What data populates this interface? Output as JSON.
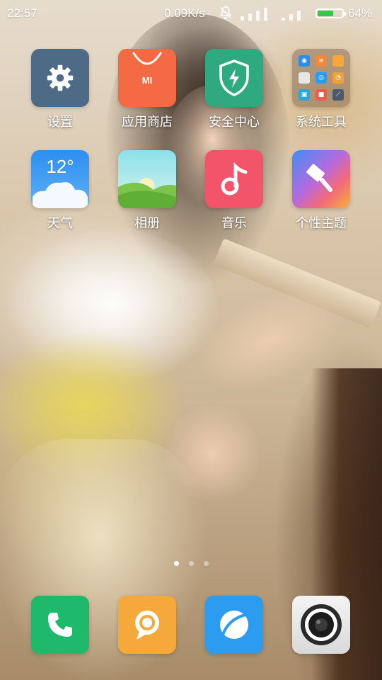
{
  "status_bar": {
    "time": "22:57",
    "net_speed": "0.09K/s",
    "battery_percent": "64%",
    "battery_level": 0.64,
    "battery_color": "#35c94a"
  },
  "home": {
    "rows": [
      [
        {
          "label": "设置",
          "icon": "gear-icon",
          "color": "#4d6a87"
        },
        {
          "label": "应用商店",
          "icon": "shopping-bag-icon",
          "color": "#f46a45",
          "icon_text": "MI"
        },
        {
          "label": "安全中心",
          "icon": "shield-lightning-icon",
          "color": "#2faa80"
        },
        {
          "label": "系统工具",
          "icon": "folder-icon",
          "color": "#7a5c46"
        }
      ],
      [
        {
          "label": "天气",
          "icon": "weather-cloud-icon",
          "color": "#2f93e6",
          "icon_text": "12°"
        },
        {
          "label": "相册",
          "icon": "gallery-landscape-icon",
          "color": "#8fd7e6"
        },
        {
          "label": "音乐",
          "icon": "music-note-icon",
          "color": "#f2546a"
        },
        {
          "label": "个性主题",
          "icon": "theme-brush-icon",
          "color": "#9a6ae6"
        }
      ]
    ],
    "pages": {
      "count": 3,
      "current": 1
    }
  },
  "dock": [
    {
      "label": "电话",
      "icon": "phone-icon",
      "color": "#1fb96b"
    },
    {
      "label": "短信",
      "icon": "message-bubble-icon",
      "color": "#f5a93a"
    },
    {
      "label": "浏览器",
      "icon": "browser-icon",
      "color": "#2b9cf0"
    },
    {
      "label": "相机",
      "icon": "camera-icon",
      "color": "#e8e8e8"
    }
  ]
}
